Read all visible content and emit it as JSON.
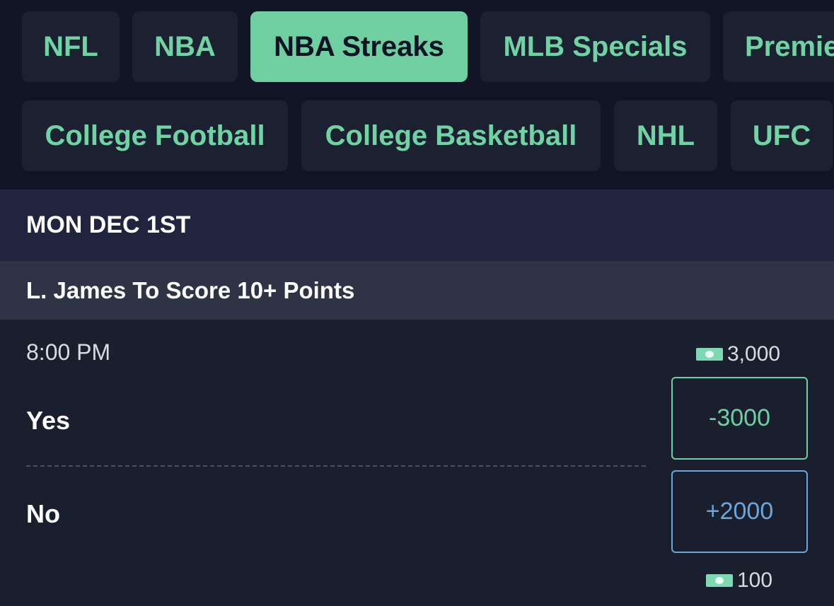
{
  "tabs_row1": [
    {
      "label": "NFL",
      "active": false
    },
    {
      "label": "NBA",
      "active": false
    },
    {
      "label": "NBA Streaks",
      "active": true
    },
    {
      "label": "MLB Specials",
      "active": false
    },
    {
      "label": "Premie",
      "active": false
    }
  ],
  "tabs_row2": [
    {
      "label": "College Football",
      "active": false
    },
    {
      "label": "College Basketball",
      "active": false
    },
    {
      "label": "NHL",
      "active": false
    },
    {
      "label": "UFC",
      "active": false
    }
  ],
  "date": "MON DEC 1ST",
  "market": {
    "title": "L. James To Score 10+ Points",
    "time": "8:00 PM",
    "outcomes": [
      {
        "label": "Yes",
        "odds": "-3000",
        "payout": "3,000",
        "accent": "#6fcfa0"
      },
      {
        "label": "No",
        "odds": "+2000",
        "payout": "100",
        "accent": "#6aa6dc"
      }
    ]
  },
  "icons": {
    "payout_icon": "cash-icon"
  }
}
